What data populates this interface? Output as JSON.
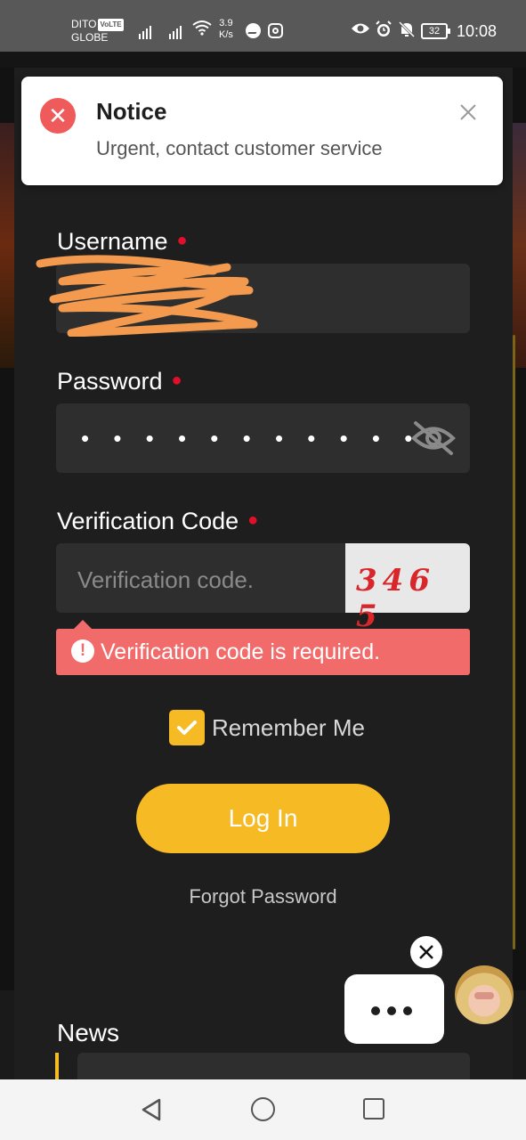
{
  "status_bar": {
    "carrier_top": "DITO",
    "volte": "VoLTE",
    "carrier_bottom": "GLOBE",
    "speed_value": "3.9",
    "speed_unit": "K/s",
    "battery": "32",
    "time": "10:08"
  },
  "notice": {
    "title": "Notice",
    "message": "Urgent, contact customer service"
  },
  "form": {
    "username_label": "Username",
    "password_label": "Password",
    "password_mask": "• • • • • • • • • • •",
    "verification_label": "Verification Code",
    "verification_placeholder": "Verification code.",
    "captcha_text": "346 5",
    "error_message": "Verification code is required.",
    "remember_label": "Remember Me",
    "remember_checked": true,
    "login_button": "Log In",
    "forgot_password": "Forgot Password"
  },
  "news": {
    "title": "News"
  },
  "colors": {
    "accent": "#f6bb24",
    "error": "#f26b6b",
    "required": "#e0102a",
    "panel": "#1e1e1e",
    "input": "#2e2e2e"
  },
  "icons": {
    "notice": "error-circle-icon",
    "password_toggle": "eye-slash-icon",
    "error": "exclamation-icon",
    "checkbox": "check-icon",
    "chat_close": "close-icon"
  }
}
